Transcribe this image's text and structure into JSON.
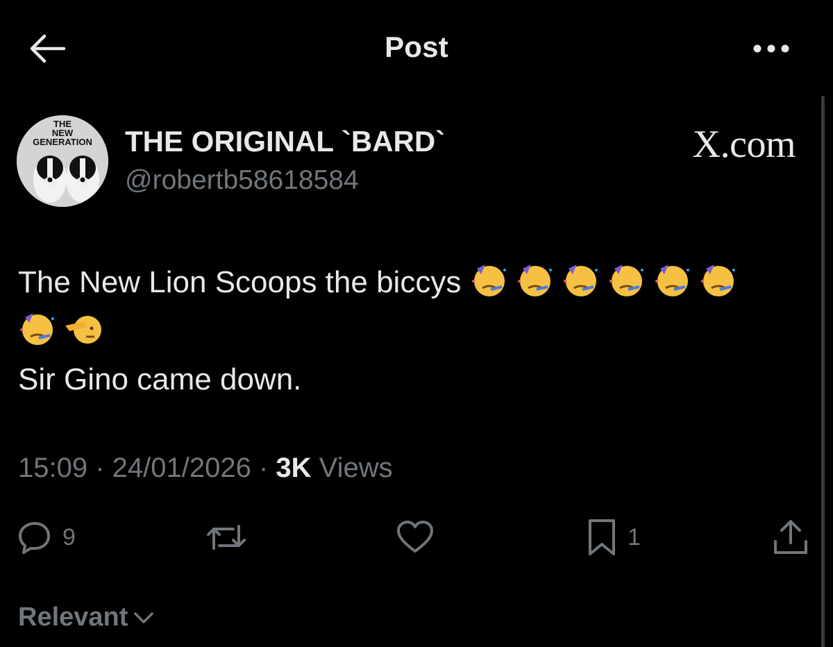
{
  "header": {
    "back_icon": "arrow-left-icon",
    "title": "Post",
    "more_icon": "more-horizontal-icon"
  },
  "author": {
    "avatar_text_line1": "THE",
    "avatar_text_line2": "NEW",
    "avatar_text_line3": "GENERATION",
    "name": "THE ORIGINAL `BARD`",
    "handle": "@robertb58618584"
  },
  "watermark": "X.com",
  "post": {
    "line1_text": "The New Lion Scoops the biccys ",
    "line1_emoji_count": 6,
    "line2_emoji": [
      "partying-face-emoji",
      "saluting-face-emoji"
    ],
    "line3_text": "Sir Gino came down."
  },
  "meta": {
    "time": "15:09",
    "separator1": " · ",
    "date": "24/01/2026",
    "separator2": " · ",
    "views_count": "3K",
    "views_label": " Views"
  },
  "actions": {
    "reply_icon": "reply-icon",
    "reply_count": "9",
    "repost_icon": "repost-icon",
    "like_icon": "heart-icon",
    "bookmark_icon": "bookmark-icon",
    "bookmark_count": "1",
    "share_icon": "share-icon"
  },
  "sort": {
    "label": "Relevant",
    "icon": "chevron-down-icon"
  },
  "colors": {
    "background": "#000000",
    "primary_text": "#e7e9ea",
    "secondary_text": "#71767b"
  }
}
